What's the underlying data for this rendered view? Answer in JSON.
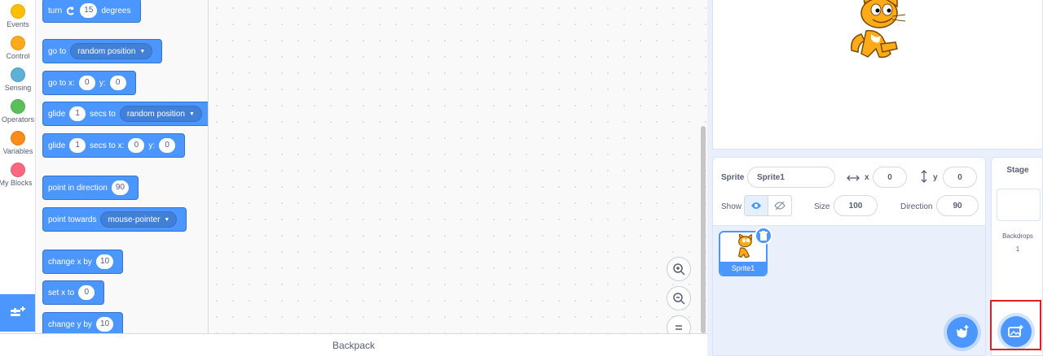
{
  "categories": [
    {
      "name": "Events",
      "color": "#ffbf00"
    },
    {
      "name": "Control",
      "color": "#ffab19"
    },
    {
      "name": "Sensing",
      "color": "#5cb1d6"
    },
    {
      "name": "Operators",
      "color": "#59c059"
    },
    {
      "name": "Variables",
      "color": "#ff8c1a"
    },
    {
      "name": "My Blocks",
      "color": "#ff6680"
    }
  ],
  "blocks": {
    "turn": {
      "label": "turn",
      "value": "15",
      "suffix": "degrees"
    },
    "goto": {
      "label": "go to",
      "dropdown": "random position"
    },
    "gotoxy": {
      "label": "go to x:",
      "x": "0",
      "y_label": "y:",
      "y": "0"
    },
    "glide_to": {
      "label": "glide",
      "value": "1",
      "mid": "secs to",
      "dropdown": "random position"
    },
    "glide_xy": {
      "label": "glide",
      "value": "1",
      "mid": "secs to x:",
      "x": "0",
      "y_label": "y:",
      "y": "0"
    },
    "point_dir": {
      "label": "point in direction",
      "value": "90"
    },
    "point_towards": {
      "label": "point towards",
      "dropdown": "mouse-pointer"
    },
    "change_x": {
      "label": "change x by",
      "value": "10"
    },
    "set_x": {
      "label": "set x to",
      "value": "0"
    },
    "change_y": {
      "label": "change y by",
      "value": "10"
    }
  },
  "backpack": "Backpack",
  "sprite_info": {
    "sprite_label": "Sprite",
    "sprite_name": "Sprite1",
    "x_label": "x",
    "x": "0",
    "y_label": "y",
    "y": "0",
    "show_label": "Show",
    "size_label": "Size",
    "size": "100",
    "direction_label": "Direction",
    "direction": "90"
  },
  "sprites": [
    {
      "name": "Sprite1"
    }
  ],
  "stage_pane": {
    "title": "Stage",
    "backdrops_label": "Backdrops",
    "backdrops_count": "1"
  },
  "icons": [
    "zoom-in-icon",
    "zoom-out-icon",
    "zoom-reset-icon",
    "add-extension-icon",
    "trash-icon",
    "choose-sprite-icon",
    "choose-backdrop-icon",
    "show-visible-icon",
    "show-hidden-icon"
  ],
  "colors": {
    "accent": "#4c97ff",
    "highlight": "#e02020"
  }
}
